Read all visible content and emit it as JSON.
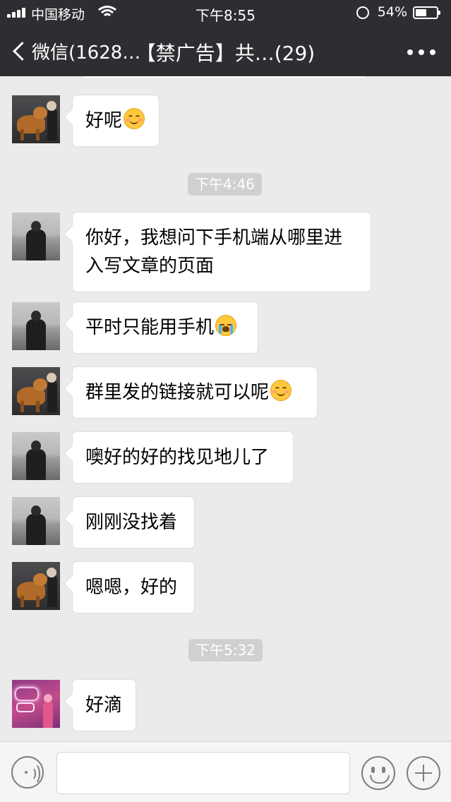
{
  "status_bar": {
    "carrier": "中国移动",
    "time": "下午8:55",
    "battery": "54%",
    "battery_level": 0.54,
    "icons": [
      "signal-icon",
      "wifi-icon",
      "orientation-lock-icon",
      "battery-icon"
    ]
  },
  "nav": {
    "back_label": "微信(1628…",
    "title": "【禁广告】共…(29)",
    "icons": [
      "back-chevron-icon",
      "more-icon"
    ]
  },
  "chat": {
    "messages": [
      {
        "avatar": "dog-avatar",
        "text": "好呢",
        "emoji": "smile"
      },
      {
        "timestamp": "下午4:46"
      },
      {
        "avatar": "girl-avatar",
        "text": "你好，我想问下手机端从哪里进\n入写文章的页面"
      },
      {
        "avatar": "girl-avatar",
        "text": "平时只能用手机",
        "emoji": "cry"
      },
      {
        "avatar": "dog-avatar",
        "text": "群里发的链接就可以呢",
        "emoji": "smile"
      },
      {
        "avatar": "girl-avatar",
        "text": "噢好的好的找见地儿了"
      },
      {
        "avatar": "girl-avatar",
        "text": "刚刚没找着"
      },
      {
        "avatar": "dog-avatar",
        "text": "嗯嗯，好的"
      },
      {
        "timestamp": "下午5:32"
      },
      {
        "avatar": "neon-avatar",
        "text": "好滴"
      }
    ]
  },
  "input_bar": {
    "value": "",
    "icons": [
      "voice-icon",
      "emoji-icon",
      "plus-icon"
    ]
  },
  "colors": {
    "header": "#2e2e32",
    "chat_background": "#ebebeb",
    "bubble": "#ffffff",
    "timestamp_pill": "#d0d0d0"
  }
}
